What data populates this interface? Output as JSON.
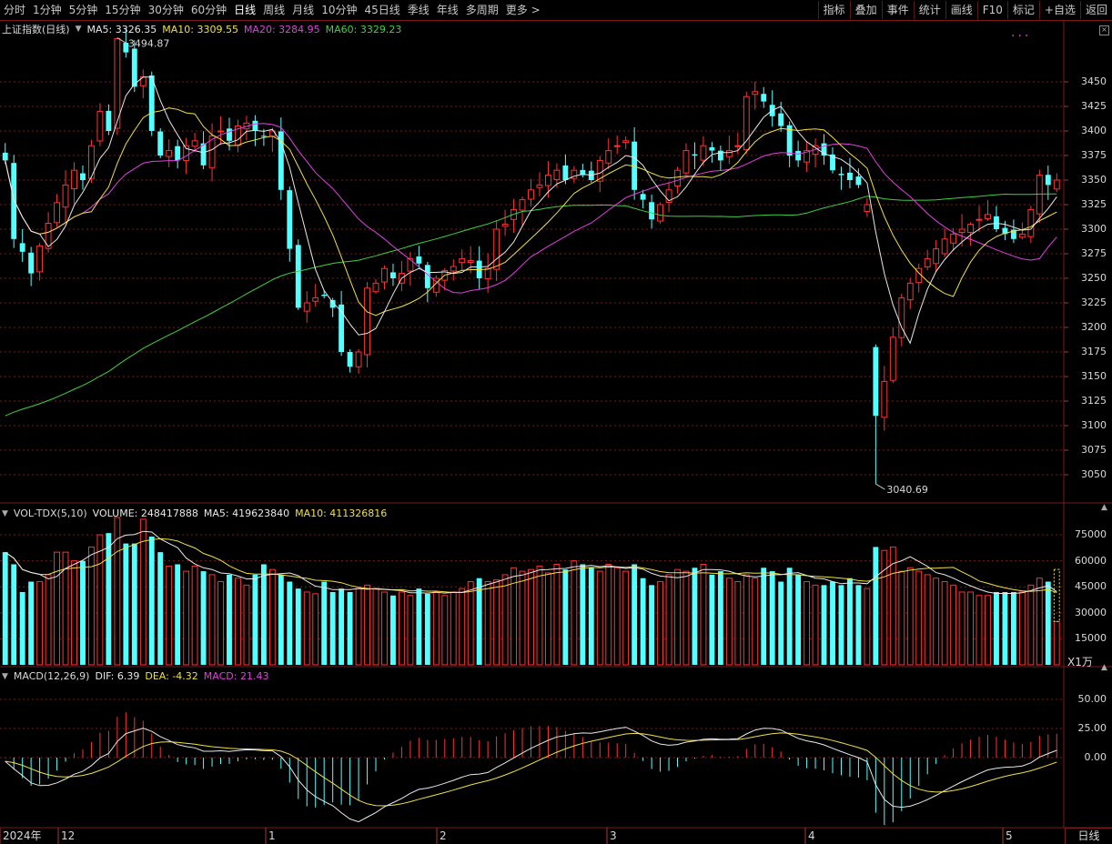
{
  "toolbar": {
    "periods": [
      "分时",
      "1分钟",
      "5分钟",
      "15分钟",
      "30分钟",
      "60分钟",
      "日线",
      "周线",
      "月线",
      "10分钟",
      "45日线",
      "季线",
      "年线",
      "多周期",
      "更多 >"
    ],
    "active_period": "日线",
    "right_buttons": [
      "指标",
      "叠加",
      "事件",
      "统计",
      "画线",
      "F10",
      "标记",
      "+自选",
      "返回"
    ]
  },
  "price_panel": {
    "title": "上证指数(日线)",
    "ma_items": [
      {
        "label": "MA5: 3326.35",
        "color": "#e8e8e8"
      },
      {
        "label": "MA10: 3309.55",
        "color": "#f0e040"
      },
      {
        "label": "MA20: 3284.95",
        "color": "#e040e0"
      },
      {
        "label": "MA60: 3329.23",
        "color": "#40d040"
      }
    ],
    "y_ticks": [
      "3450",
      "3425",
      "3400",
      "3375",
      "3350",
      "3325",
      "3300",
      "3275",
      "3250",
      "3225",
      "3200",
      "3175",
      "3150",
      "3125",
      "3100",
      "3075",
      "3050"
    ],
    "high_label": "3494.87",
    "low_label": "3040.69"
  },
  "volume_panel": {
    "title": "VOL-TDX(5,10)",
    "items": [
      {
        "label": "VOLUME: 248417888",
        "color": "#e8e8e8"
      },
      {
        "label": "MA5: 419623840",
        "color": "#e8e8e8"
      },
      {
        "label": "MA10: 411326816",
        "color": "#f0e040"
      }
    ],
    "y_ticks": [
      "75000",
      "60000",
      "45000",
      "30000",
      "15000"
    ],
    "unit": "X1万"
  },
  "macd_panel": {
    "title": "MACD(12,26,9)",
    "items": [
      {
        "label": "DIF: 6.39",
        "color": "#e8e8e8"
      },
      {
        "label": "DEA: -4.32",
        "color": "#f0e040"
      },
      {
        "label": "MACD: 21.43",
        "color": "#e040e0"
      }
    ],
    "y_ticks": [
      "50.00",
      "25.00",
      "0.00"
    ]
  },
  "date_axis": {
    "labels": [
      "2024年",
      "12",
      "1",
      "2",
      "3",
      "4",
      "5"
    ]
  },
  "bottom_tab": "日线",
  "colors": {
    "up": "#ff3232",
    "down": "#54ffff",
    "ma5": "#e8e8e8",
    "ma10": "#f0e040",
    "ma20": "#e040e0",
    "ma60": "#40d040",
    "grid": "#7a1a1a"
  },
  "chart_data": [
    {
      "type": "candlestick",
      "title": "上证指数(日线)",
      "ylim": [
        3040,
        3500
      ],
      "high": 3494.87,
      "low": 3040.69,
      "closes": [
        3370,
        3290,
        3277,
        3255,
        3283,
        3306,
        3327,
        3345,
        3360,
        3350,
        3385,
        3420,
        3400,
        3494,
        3480,
        3445,
        3455,
        3400,
        3375,
        3380,
        3370,
        3385,
        3390,
        3365,
        3395,
        3400,
        3390,
        3405,
        3408,
        3400,
        3395,
        3400,
        3340,
        3280,
        3220,
        3225,
        3230,
        3232,
        3220,
        3175,
        3160,
        3175,
        3240,
        3245,
        3260,
        3250,
        3255,
        3270,
        3265,
        3240,
        3250,
        3258,
        3262,
        3270,
        3268,
        3250,
        3260,
        3300,
        3305,
        3320,
        3330,
        3340,
        3345,
        3355,
        3360,
        3350,
        3360,
        3355,
        3350,
        3370,
        3380,
        3385,
        3390,
        3340,
        3330,
        3310,
        3325,
        3340,
        3360,
        3380,
        3375,
        3385,
        3380,
        3370,
        3380,
        3385,
        3435,
        3440,
        3430,
        3415,
        3405,
        3375,
        3370,
        3380,
        3385,
        3375,
        3360,
        3355,
        3350,
        3345,
        3325,
        3110,
        3145,
        3190,
        3230,
        3245,
        3260,
        3270,
        3280,
        3290,
        3295,
        3300,
        3305,
        3310,
        3315,
        3300,
        3295,
        3290,
        3295,
        3320,
        3355,
        3345,
        3350
      ]
    },
    {
      "type": "bar",
      "title": "VOL-TDX(5,10)",
      "ylim": [
        0,
        85000
      ],
      "unit": "万",
      "volumes": [
        65000,
        58000,
        42000,
        48000,
        48000,
        52000,
        65000,
        65000,
        60000,
        60000,
        68000,
        75000,
        76000,
        85000,
        70000,
        70000,
        84000,
        74000,
        65000,
        57000,
        58000,
        54000,
        57000,
        54000,
        52000,
        48000,
        52000,
        50000,
        46000,
        52000,
        58000,
        55000,
        52000,
        48000,
        44000,
        42000,
        41000,
        48000,
        42000,
        44000,
        42000,
        44000,
        46000,
        44000,
        42000,
        40000,
        42000,
        40000,
        44000,
        41000,
        42000,
        40000,
        42000,
        44000,
        48000,
        50000,
        48000,
        49000,
        52000,
        56000,
        54000,
        55000,
        57000,
        53000,
        58000,
        55000,
        60000,
        58000,
        56000,
        54000,
        58000,
        56000,
        54000,
        58000,
        50000,
        46000,
        48000,
        52000,
        55000,
        54000,
        56000,
        58000,
        52000,
        54000,
        50000,
        48000,
        52000,
        50000,
        56000,
        54000,
        48000,
        56000,
        52000,
        48000,
        46000,
        46000,
        48000,
        46000,
        50000,
        46000,
        44000,
        68000,
        66000,
        68000,
        54000,
        56000,
        54000,
        52000,
        50000,
        48000,
        46000,
        42000,
        42000,
        40000,
        40000,
        42000,
        42000,
        42000,
        42000,
        46000,
        50000,
        48000,
        25000
      ],
      "ma5_last": 419623840,
      "ma10_last": 411326816
    },
    {
      "type": "macd",
      "title": "MACD(12,26,9)",
      "ylim": [
        -60,
        70
      ],
      "dif_last": 6.39,
      "dea_last": -4.32,
      "macd_last": 21.43
    }
  ]
}
